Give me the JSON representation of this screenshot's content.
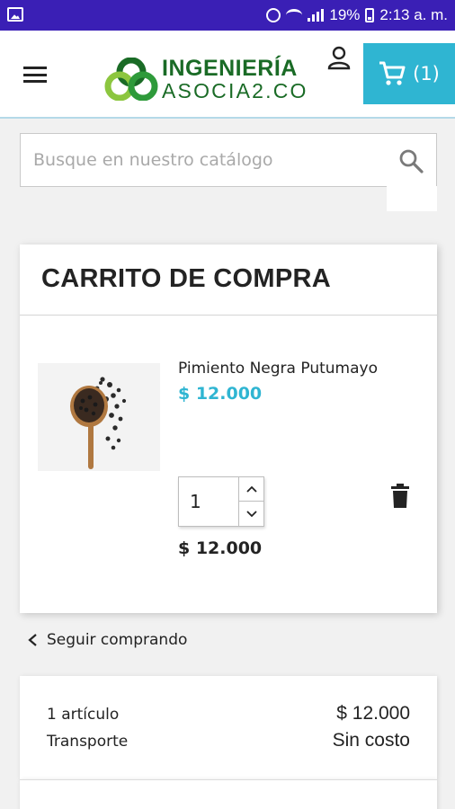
{
  "status_bar": {
    "battery": "19%",
    "time": "2:13 a. m."
  },
  "header": {
    "logo_line1": "INGENIERÍA",
    "logo_line2": "ASOCIA2.CO",
    "cart_count": "(1)"
  },
  "search": {
    "placeholder": "Busque en nuestro catálogo"
  },
  "cart": {
    "title": "CARRITO DE COMPRA",
    "item": {
      "name": "Pimiento Negra Putumayo",
      "price": "$ 12.000",
      "quantity": "1",
      "line_total": "$ 12.000"
    }
  },
  "continue_shopping": "Seguir comprando",
  "summary": {
    "items_label": "1 artículo",
    "items_value": "$ 12.000",
    "shipping_label": "Transporte",
    "shipping_value": "Sin costo"
  },
  "colors": {
    "status_bar": "#3a1fb5",
    "accent": "#2fb5d2",
    "logo_green": "#1a6b26"
  }
}
